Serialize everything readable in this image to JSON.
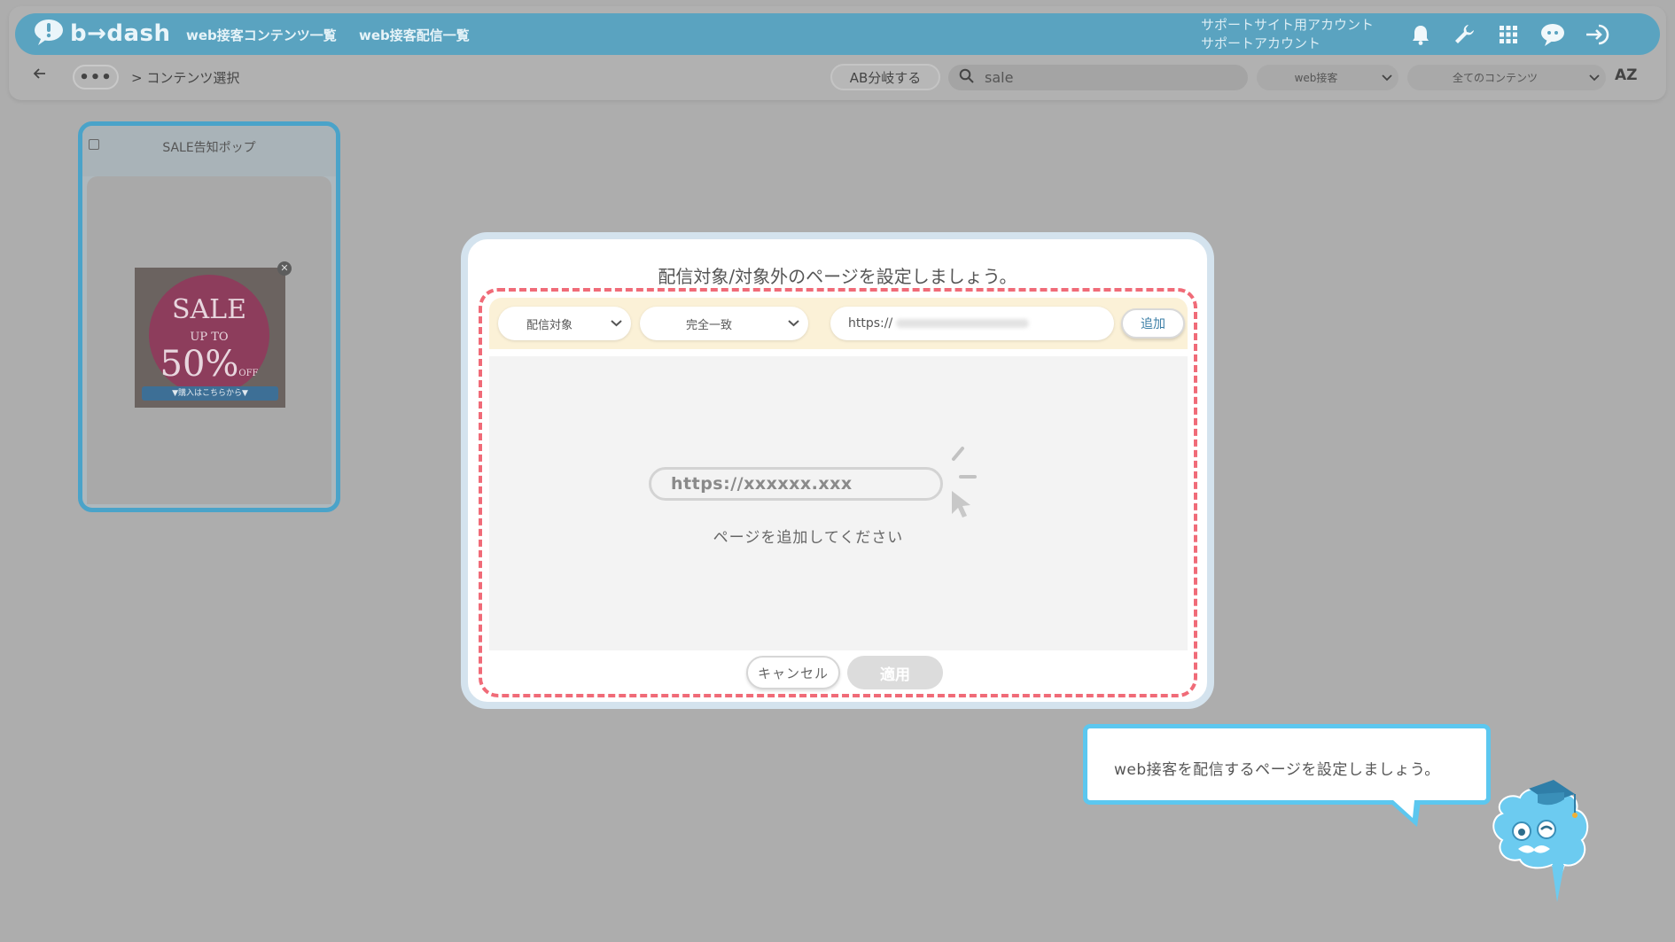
{
  "header": {
    "logo_text": "b→dash",
    "nav_links": [
      "web接客コンテンツ一覧",
      "web接客配信一覧"
    ],
    "account_line1": "サポートサイト用アカウント",
    "account_line2": "サポートアカウント"
  },
  "toolbar": {
    "more_label": "•••",
    "breadcrumb": "> コンテンツ選択",
    "ab_button": "AB分岐する",
    "search_value": "sale",
    "type_select": "web接客",
    "content_select": "全てのコンテンツ",
    "sort_label": "AZ"
  },
  "card": {
    "title": "SALE告知ポップ",
    "banner": {
      "sale": "SALE",
      "up_to": "UP TO",
      "percent": "50%",
      "off": "OFF",
      "cta": "▼購入はこちらから▼"
    }
  },
  "modal": {
    "title": "配信対象/対象外のページを設定しましょう。",
    "target_select": "配信対象",
    "match_select": "完全一致",
    "url_prefix": "https://",
    "add_button": "追加",
    "empty_placeholder": "https://xxxxxx.xxx",
    "empty_message": "ページを追加してください",
    "cancel_button": "キャンセル",
    "apply_button": "適用"
  },
  "tooltip": {
    "text": "web接客を配信するページを設定しましょう。"
  },
  "colors": {
    "brand_blue": "#5aa3c0",
    "highlight_red": "#f06b78",
    "tooltip_border": "#5cc7ef",
    "card_border": "#4aa3c9"
  }
}
